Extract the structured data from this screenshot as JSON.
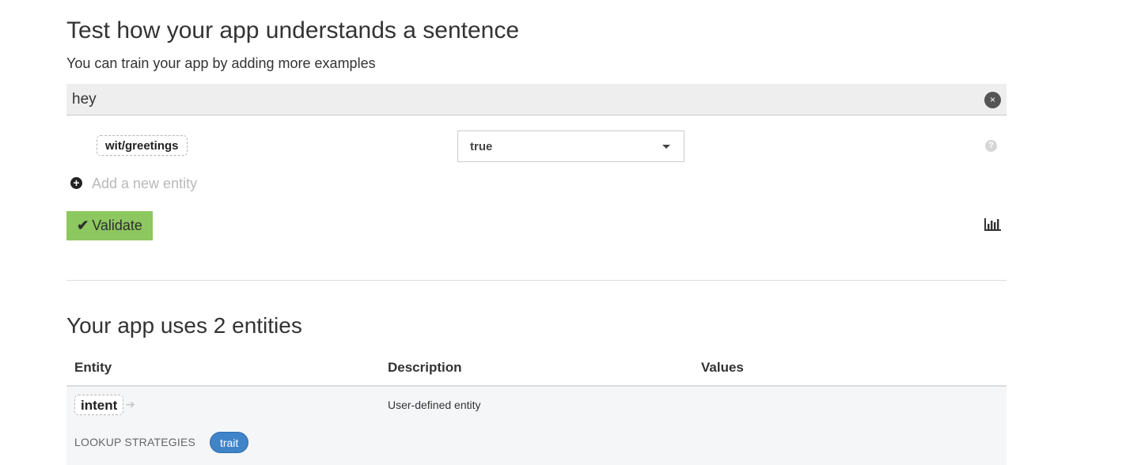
{
  "test_section": {
    "title": "Test how your app understands a sentence",
    "subtitle": "You can train your app by adding more examples",
    "sentence_value": "hey",
    "clear_icon": "×",
    "entity": {
      "name": "wit/greetings",
      "value": "true"
    },
    "help_icon": "?",
    "add_entity_icon": "+",
    "add_entity_label": "Add a new entity",
    "validate_icon": "✔",
    "validate_label": "Validate",
    "colors": {
      "validate_bg": "#8cc75f",
      "trait_badge": "#3f83c8"
    }
  },
  "entities_section": {
    "title": "Your app uses 2 entities",
    "columns": [
      "Entity",
      "Description",
      "Values"
    ],
    "rows": [
      {
        "entity": "intent",
        "arrow_icon": "➔",
        "description": "User-defined entity",
        "lookup_label": "LOOKUP STRATEGIES",
        "lookup_strategies": [
          "trait"
        ]
      }
    ]
  }
}
